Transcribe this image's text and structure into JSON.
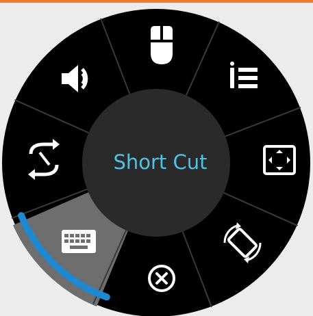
{
  "colors": {
    "accent_orange": "#F07C2B",
    "background": "#ECECEC",
    "wheel": "#000000",
    "center": "#2A2A2A",
    "selected_segment": "#6E6E6E",
    "text_cyan": "#4FC3E7",
    "arc_blue": "#1E88D0",
    "icon_white": "#FFFFFF"
  },
  "center": {
    "label": "Short Cut"
  },
  "segments": [
    {
      "name": "mouse",
      "icon": "mouse-icon",
      "selected": false
    },
    {
      "name": "list",
      "icon": "list-icon",
      "selected": false
    },
    {
      "name": "fit-screen",
      "icon": "fit-screen-icon",
      "selected": false
    },
    {
      "name": "rotate-screen",
      "icon": "rotate-screen-icon",
      "selected": false
    },
    {
      "name": "close",
      "icon": "close-circle-icon",
      "selected": false
    },
    {
      "name": "keyboard",
      "icon": "keyboard-icon",
      "selected": true
    },
    {
      "name": "switch",
      "icon": "switch-arrows-icon",
      "selected": false
    },
    {
      "name": "volume",
      "icon": "volume-icon",
      "selected": false
    }
  ]
}
